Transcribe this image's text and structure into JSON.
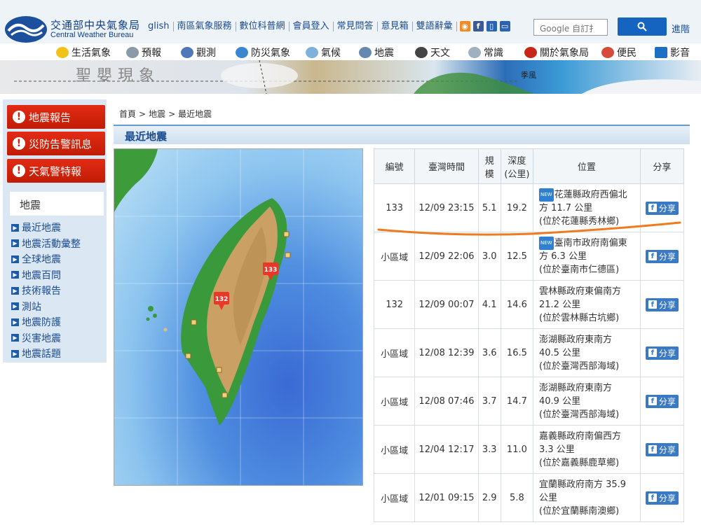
{
  "header": {
    "logo_zh": "交通部中央氣象局",
    "logo_en": "Central Weather Bureau",
    "top_links": [
      "glish",
      "南區氣象服務",
      "數位科普網",
      "會員登入",
      "常見問答",
      "意見箱",
      "雙語辭彙"
    ],
    "google_placeholder": "Google 自訂扌",
    "advanced_link": "進階"
  },
  "main_nav": [
    "生活氣象",
    "預報",
    "觀測",
    "防災氣象",
    "氣候",
    "地震",
    "天文",
    "常識",
    "關於氣象局",
    "便民",
    "影音"
  ],
  "banner": {
    "title": "聖嬰現象",
    "note": "季風"
  },
  "sidebar": {
    "alerts": [
      "地震報告",
      "災防告警訊息",
      "天氣警特報"
    ],
    "section_title": "地震",
    "items": [
      "最近地震",
      "地震活動彙整",
      "全球地震",
      "地震百問",
      "技術報告",
      "測站",
      "地震防護",
      "災害地震",
      "地震話題"
    ]
  },
  "breadcrumb": [
    "首頁",
    "地震",
    "最近地震"
  ],
  "breadcrumb_sep": ">",
  "panel_title": "最近地震",
  "map": {
    "markers": [
      "133",
      "132"
    ]
  },
  "table": {
    "headers": {
      "no": "編號",
      "time": "臺灣時間",
      "mag_1": "規",
      "mag_2": "模",
      "depth_1": "深度",
      "depth_2": "(公里)",
      "loc": "位置",
      "share": "分享"
    },
    "new_tag": "NEW",
    "share_label": "分享",
    "rows": [
      {
        "no": "133",
        "time": "12/09 23:15",
        "mag": "5.1",
        "depth": "19.2",
        "loc1": "花蓮縣政府西偏北",
        "loc2": "方 11.7 公里",
        "loc3": "(位於花蓮縣秀林鄉)",
        "new": true
      },
      {
        "no": "小區域",
        "time": "12/09 22:06",
        "mag": "3.0",
        "depth": "12.5",
        "loc1": "臺南市政府南偏東",
        "loc2": "方 6.3 公里",
        "loc3": "(位於臺南市仁德區)",
        "new": true
      },
      {
        "no": "132",
        "time": "12/09 00:07",
        "mag": "4.1",
        "depth": "14.6",
        "loc1": "雲林縣政府東偏南方",
        "loc2": "21.2 公里",
        "loc3": "(位於雲林縣古坑鄉)",
        "new": false
      },
      {
        "no": "小區域",
        "time": "12/08 12:39",
        "mag": "3.6",
        "depth": "16.5",
        "loc1": "澎湖縣政府東南方",
        "loc2": "40.5 公里",
        "loc3": "(位於臺灣西部海域)",
        "new": false
      },
      {
        "no": "小區域",
        "time": "12/08 07:46",
        "mag": "3.7",
        "depth": "14.7",
        "loc1": "澎湖縣政府東南方",
        "loc2": "40.9 公里",
        "loc3": "(位於臺灣西部海域)",
        "new": false
      },
      {
        "no": "小區域",
        "time": "12/04 12:17",
        "mag": "3.3",
        "depth": "11.0",
        "loc1": "嘉義縣政府南偏西方",
        "loc2": "3.3 公里",
        "loc3": "(位於嘉義縣鹿草鄉)",
        "new": false
      },
      {
        "no": "小區域",
        "time": "12/01 09:15",
        "mag": "2.9",
        "depth": "5.8",
        "loc1": "宜蘭縣政府南方 35.9",
        "loc2": "公里",
        "loc3": "(位於宜蘭縣南澳鄉)",
        "new": false
      }
    ]
  },
  "colors": {
    "accent": "#1565c0",
    "alert_red": "#d0240c",
    "annotation": "#f07a1f"
  },
  "icons": [
    "logo-mark",
    "rss-icon",
    "facebook-icon",
    "mobile-icon",
    "search-icon",
    "alert-icon",
    "arrow-icon",
    "earthquake-marker"
  ]
}
